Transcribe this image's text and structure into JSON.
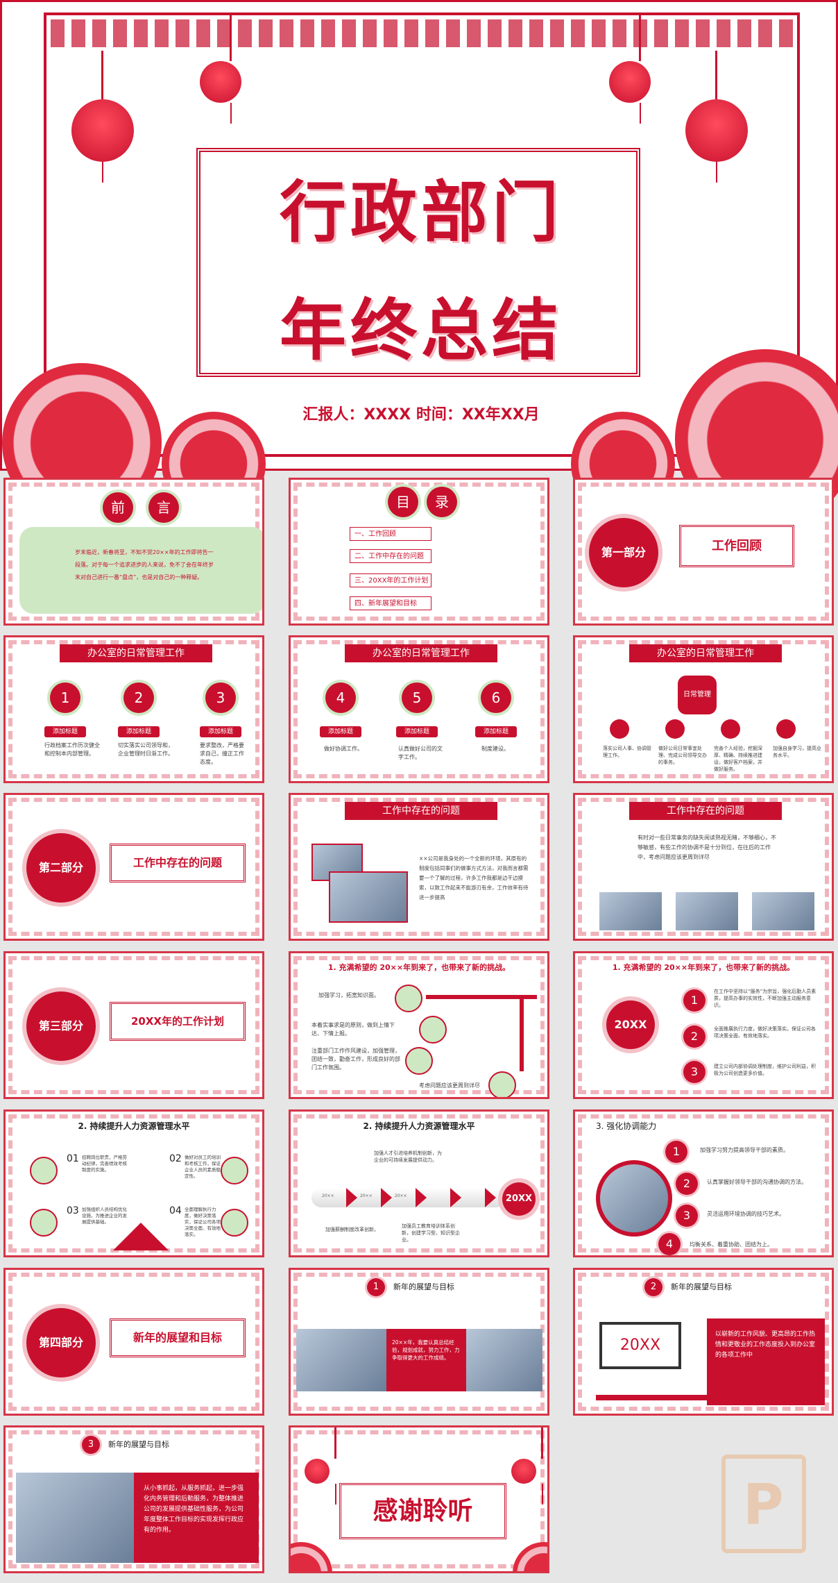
{
  "cover": {
    "title_line1": "行政部门",
    "title_line2": "年终总结",
    "reporter": "汇报人：XXXX 时间：XX年XX月"
  },
  "slides": {
    "preface": {
      "c1": "前",
      "c2": "言",
      "text": "岁末临近，新春将至，不知不觉20××年的工作即将告一段落。对于每一个追求进步的人来说，免不了会在年终岁末对自己进行一番“盘点”，也是对自己的一种释疑。"
    },
    "toc": {
      "c1": "目",
      "c2": "录",
      "items": [
        "一、工作回顾",
        "二、工作中存在的问题",
        "三、20XX年的工作计划",
        "四、新年展望和目标"
      ]
    },
    "part1": {
      "circle": "第一部分",
      "title": "工作回顾"
    },
    "daily1": {
      "header": "办公室的日常管理工作",
      "nums": [
        "1",
        "2",
        "3"
      ],
      "tag": "添加标题",
      "texts": [
        "行政档案工作历次健全和控制本内部管理。",
        "切实落实公司领导和，企业管理时日渐工作。",
        "要求整改，严格要求自己，撞正工作态度。"
      ]
    },
    "daily2": {
      "header": "办公室的日常管理工作",
      "nums": [
        "4",
        "5",
        "6"
      ],
      "tag": "添加标题",
      "texts": [
        "做好协调工作。",
        "认真做好公司的文字工作。",
        "制度建设。"
      ]
    },
    "daily3": {
      "header": "办公室的日常管理工作",
      "center": "日常管理",
      "texts": [
        "落实公司人事、协调管理工作。",
        "做好公司日常事宜处理、完成公司领导交办的事务。",
        "完善个人经验，挖掘深厚、精确、持续推进建设，做好客户档案，并做好服务。",
        "加强自身学习，提高业务水平。"
      ]
    },
    "part2": {
      "circle": "第二部分",
      "title": "工作中存在的问题"
    },
    "problems1": {
      "header": "工作中存在的问题",
      "text": "××公司是我身处的一个全新的环境，其原有的制度包括同事们的做事方式方法，对我而言都需要一个了解的过程，许多工作我都是边干边摸索，以致工作起来不能游刃有余，工作效率有待进一步提高"
    },
    "problems2": {
      "header": "工作中存在的问题",
      "text": "有时对一些日常事务的缺失阅读熟视无睹，不够细心，不够敏感，有些工作的协调不是十分到位，在往后的工作中，考虑问题应该更周到详尽"
    },
    "part3": {
      "circle": "第三部分",
      "title": "20XX年的工作计划"
    },
    "plan1": {
      "header": "1. 充满希望的 20××年到来了，也带来了新的挑战。",
      "items": [
        "加强学习，拓宽知识面。",
        "本着实事求是的原则，做到上情下达、下情上报。",
        "注重部门工作作风建设，加强管理，团结一致，勤奋工作，形成良好的部门工作氛围。",
        "考虑问题应该更周到详尽"
      ]
    },
    "plan2": {
      "header": "1. 充满希望的 20××年到来了，也带来了新的挑战。",
      "center": "20XX",
      "nums": [
        "1",
        "2",
        "3"
      ],
      "texts": [
        "在工作中坚持以“服务”为宗旨，强化后勤人员素质，提高办事的实效性，不断加强主动服务意识。",
        "全面推展执行力度，做好决策落实。保证公司各项决策全面、有效地落实。",
        "建立公司内部协调处理制度，维护公司利益，积极为公司创造更多价值。"
      ]
    },
    "hr1": {
      "header": "2. 持续提升人力资源管理水平",
      "nums": [
        "01",
        "02",
        "03",
        "04"
      ],
      "texts": [
        "招聘岗位职责，严格劳动纪律，完善绩效考核制度的实施。",
        "做好对员工的培训和考核工作，保证企业人员的素质稳定性。",
        "加强组织人员结构优化设施，为推进企业的发展提供基础。",
        "全面理解执行力度，做好决策落实，保证公司各项决策全面、有效地落实。"
      ]
    },
    "hr2": {
      "header": "2. 持续提升人力资源管理水平",
      "top_text": "加强人才引进培养机制创新，为企业的可持续发展提供动力。",
      "bottom_text1": "加强薪酬制度改革创新。",
      "bottom_text2": "加强员工教育培训体系创新，创建学习型、知识型企业。",
      "years": [
        "20××",
        "20××",
        "20××"
      ],
      "end": "20XX"
    },
    "coord": {
      "header": "3. 强化协调能力",
      "nums": [
        "1",
        "2",
        "3",
        "4"
      ],
      "texts": [
        "加强学习努力提高领导干部的素质。",
        "认真掌握好领导干部的沟通协调的方法。",
        "灵活运用环境协调的技巧艺术。",
        "均衡关系、着重协助、团结为上。"
      ]
    },
    "part4": {
      "circle": "第四部分",
      "title": "新年的展望和目标"
    },
    "outlook1": {
      "num": "1",
      "header": "新年的展望与目标",
      "text": "20××年，我要认真总结经验，规划成就，努力工作，力争取得更大的工作成绩。"
    },
    "outlook2": {
      "num": "2",
      "header": "新年的展望与目标",
      "screen": "20XX",
      "text": "以崭新的工作风貌、更高昂的工作热情和更敬业的工作态度投入到办公室的各项工作中"
    },
    "outlook3": {
      "num": "3",
      "header": "新年的展望与目标",
      "text": "从小事抓起，从服务抓起，进一步强化内务管理和后勤服务，为整体推进公司的发展提供基础性服务，为公司年度整体工作目标的实现发挥行政应有的作用。"
    },
    "thanks": {
      "title": "感谢聆听"
    }
  },
  "colors": {
    "primary": "#c8102e",
    "accent_green": "#cfe8c4",
    "bg": "#e6e6e6"
  }
}
